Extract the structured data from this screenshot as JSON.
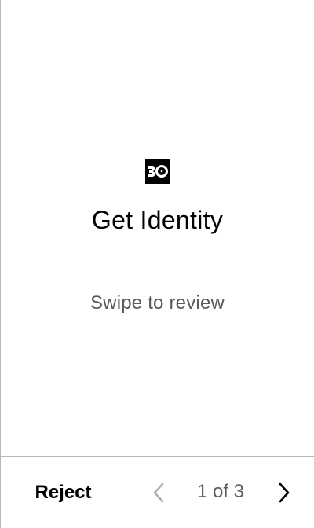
{
  "app": {
    "logo_icon": "app-logo-icon",
    "title": "Get Identity",
    "subtitle": "Swipe to review"
  },
  "bottom_bar": {
    "reject_label": "Reject",
    "pager": {
      "text": "1 of 3",
      "prev_icon": "chevron-left-icon",
      "next_icon": "chevron-right-icon"
    }
  },
  "colors": {
    "text_primary": "#000000",
    "text_secondary": "#5a5a5a",
    "divider": "#b8b8b8",
    "disabled_icon": "#b0b0b0"
  }
}
